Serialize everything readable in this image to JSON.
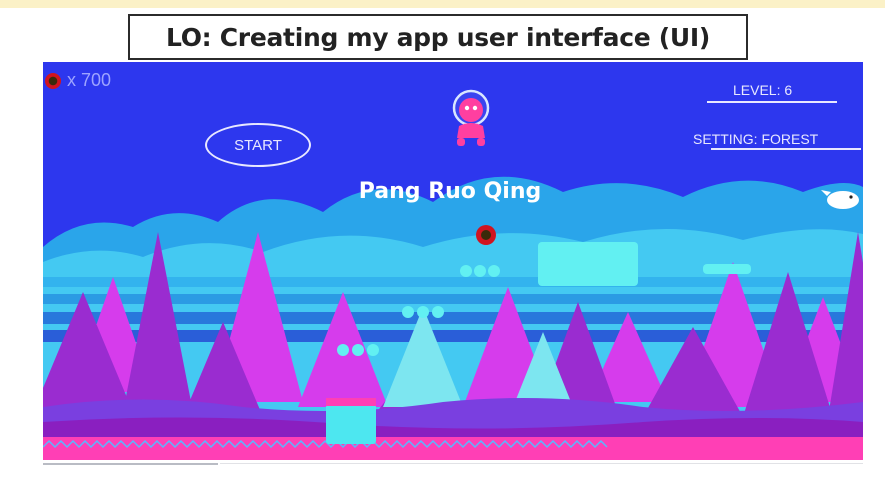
{
  "slide": {
    "title": "LO: Creating my app user interface (UI)"
  },
  "game": {
    "hud": {
      "coin_icon": "coin-icon",
      "coin_count": "x 700",
      "level_label": "LEVEL: 6",
      "setting_label": "SETTING: FOREST"
    },
    "start_label": "START",
    "author": "Pang Ruo Qing",
    "colors": {
      "sky": "#2d37ee",
      "clouds": "#36b8f0",
      "tree_purple": "#a02bd0",
      "tree_pink": "#e040e8",
      "ground": "#8a1fc0",
      "ground_trim": "#ff3fb5",
      "blocks": "#4de7f0"
    }
  }
}
